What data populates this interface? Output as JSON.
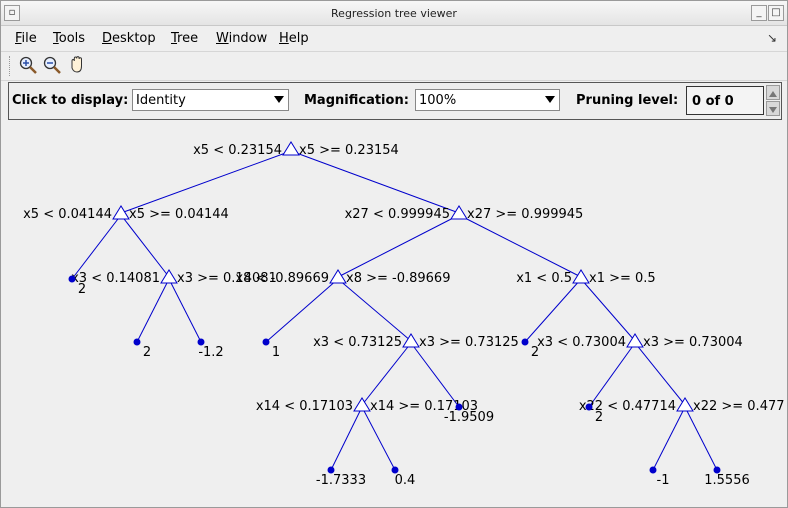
{
  "window": {
    "title": "Regression tree viewer"
  },
  "menu": {
    "items": [
      {
        "label": "File",
        "mnemonic": "F",
        "rest": "ile"
      },
      {
        "label": "Tools",
        "mnemonic": "T",
        "rest": "ools"
      },
      {
        "label": "Desktop",
        "mnemonic": "D",
        "rest": "esktop"
      },
      {
        "label": "Tree",
        "mnemonic": "T",
        "rest": "ree"
      },
      {
        "label": "Window",
        "mnemonic": "W",
        "rest": "indow"
      },
      {
        "label": "Help",
        "mnemonic": "H",
        "rest": "elp"
      }
    ]
  },
  "toolbar": {
    "buttons": [
      {
        "name": "zoom-in",
        "icon": "zoom-in-icon"
      },
      {
        "name": "zoom-out",
        "icon": "zoom-out-icon"
      },
      {
        "name": "pan",
        "icon": "hand-icon"
      }
    ]
  },
  "controls": {
    "display_label": "Click to display:",
    "display_value": "Identity",
    "magnification_label": "Magnification:",
    "magnification_value": "100%",
    "pruning_label": "Pruning level:",
    "pruning_value": "0 of 0"
  },
  "tree": {
    "line_color": "#0000cc",
    "splits": [
      {
        "id": "n1",
        "left": "x5 < 0.23154",
        "right": "x5 >= 0.23154"
      },
      {
        "id": "n2",
        "left": "x5 < 0.04144",
        "right": "x5 >= 0.04144"
      },
      {
        "id": "n3",
        "left": "x27 < 0.999945",
        "right": "x27 >= 0.999945"
      },
      {
        "id": "n5",
        "left": "x3 < 0.14081",
        "right": "x3 >= 0.14081"
      },
      {
        "id": "n6",
        "left": "x8 < -0.89669",
        "right": "x8 >= -0.89669"
      },
      {
        "id": "n7",
        "left": "x1 < 0.5",
        "right": "x1 >= 0.5"
      },
      {
        "id": "n13",
        "left": "x3 < 0.73125",
        "right": "x3 >= 0.73125"
      },
      {
        "id": "n15",
        "left": "x3 < 0.73004",
        "right": "x3 >= 0.73004"
      },
      {
        "id": "n18",
        "left": "x14 < 0.17103",
        "right": "x14 >= 0.17103"
      },
      {
        "id": "n21",
        "left": "x22 < 0.47714",
        "right": "x22 >= 0.477"
      }
    ],
    "leaves": [
      {
        "id": "l4",
        "value": "2"
      },
      {
        "id": "l10",
        "value": "2"
      },
      {
        "id": "l11",
        "value": "-1.2"
      },
      {
        "id": "l12",
        "value": "1"
      },
      {
        "id": "l14",
        "value": "2"
      },
      {
        "id": "l19",
        "value": "-1.9509"
      },
      {
        "id": "l20",
        "value": "2"
      },
      {
        "id": "l24",
        "value": "-1.7333"
      },
      {
        "id": "l25",
        "value": "0.4"
      },
      {
        "id": "l26",
        "value": "-1"
      },
      {
        "id": "l27",
        "value": "1.5556"
      }
    ]
  }
}
